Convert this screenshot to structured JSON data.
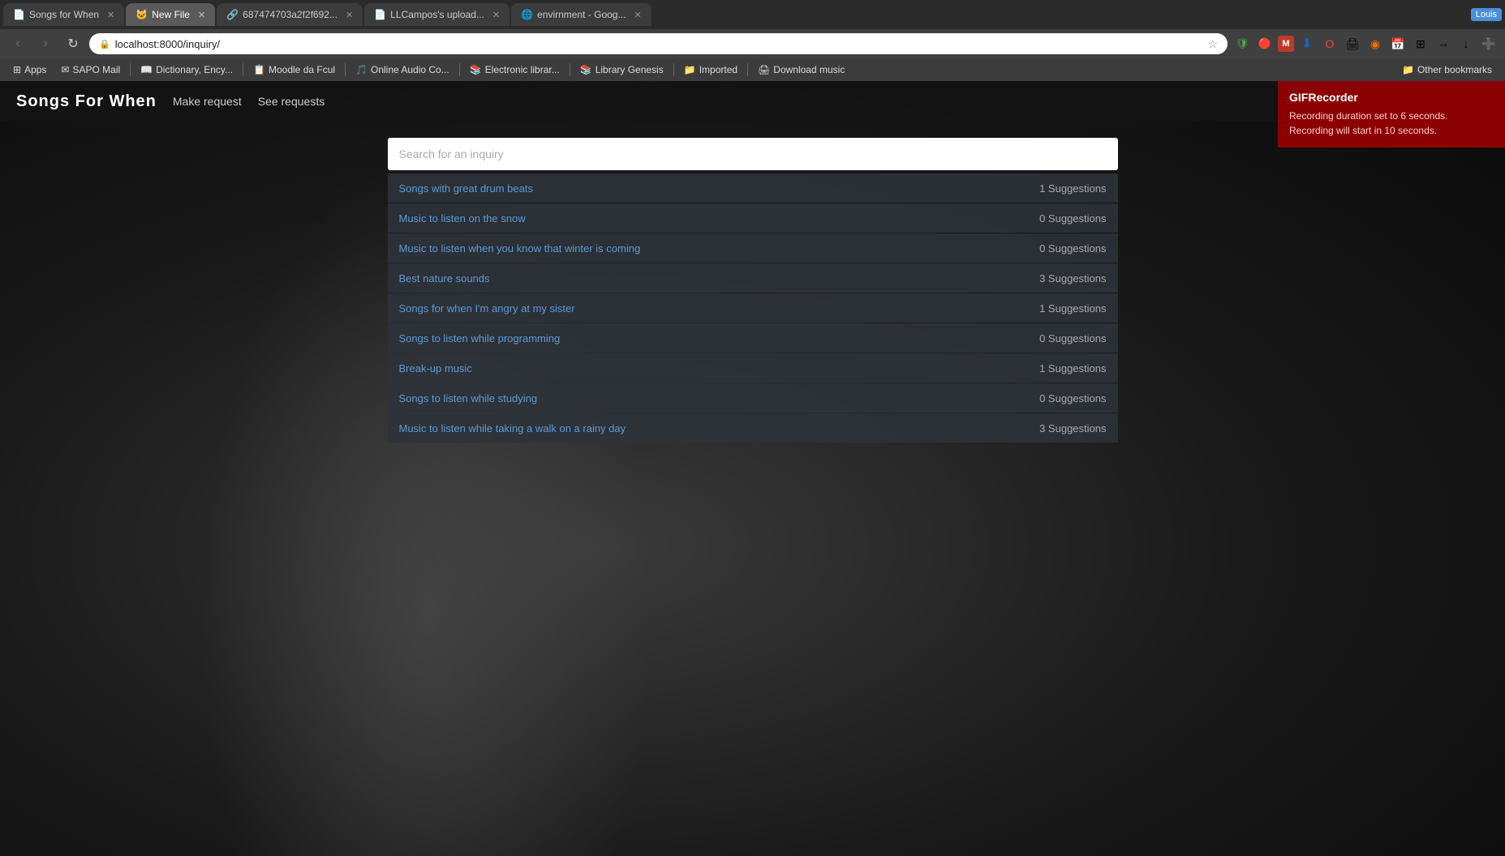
{
  "browser": {
    "tabs": [
      {
        "id": "tab1",
        "label": "Songs for When",
        "icon": "📄",
        "active": false,
        "favicon": "page"
      },
      {
        "id": "tab2",
        "label": "New File",
        "icon": "📄",
        "active": true,
        "favicon": "github"
      },
      {
        "id": "tab3",
        "label": "687474703a2f2f692...",
        "icon": "🔗",
        "active": false,
        "favicon": "link"
      },
      {
        "id": "tab4",
        "label": "LLCampos's upload...",
        "icon": "📄",
        "active": false,
        "favicon": "page"
      },
      {
        "id": "tab5",
        "label": "envirnment - Goog...",
        "icon": "🌐",
        "active": false,
        "favicon": "google"
      }
    ],
    "address": "localhost:8000/inquiry/",
    "address_display": "localhost:8000/inquiry/"
  },
  "bookmarks": [
    {
      "label": "Apps",
      "icon": "⊞"
    },
    {
      "label": "SAPO Mail",
      "icon": "✉"
    },
    {
      "label": "Dictionary, Ency...",
      "icon": "📖"
    },
    {
      "label": "Moodle da Fcul",
      "icon": "🎓"
    },
    {
      "label": "Online Audio Co...",
      "icon": "🎵"
    },
    {
      "label": "Electronic librar...",
      "icon": "📚"
    },
    {
      "label": "Library Genesis",
      "icon": "📚"
    },
    {
      "label": "Imported",
      "icon": "📁"
    },
    {
      "label": "Download music",
      "icon": "🖨"
    },
    {
      "label": "Other bookmarks",
      "icon": "📁"
    }
  ],
  "app": {
    "brand": "Songs For When",
    "nav_links": [
      {
        "label": "Make request",
        "href": "#"
      },
      {
        "label": "See requests",
        "href": "#"
      }
    ]
  },
  "search": {
    "placeholder": "Search for an inquiry"
  },
  "inquiries": [
    {
      "title": "Songs with great drum beats",
      "suggestions": 1,
      "suggestions_label": "1 Suggestions"
    },
    {
      "title": "Music to listen on the snow",
      "suggestions": 0,
      "suggestions_label": "0 Suggestions"
    },
    {
      "title": "Music to listen when you know that winter is coming",
      "suggestions": 0,
      "suggestions_label": "0 Suggestions"
    },
    {
      "title": "Best nature sounds",
      "suggestions": 3,
      "suggestions_label": "3 Suggestions"
    },
    {
      "title": "Songs for when I'm angry at my sister",
      "suggestions": 1,
      "suggestions_label": "1 Suggestions"
    },
    {
      "title": "Songs to listen while programming",
      "suggestions": 0,
      "suggestions_label": "0 Suggestions"
    },
    {
      "title": "Break-up music",
      "suggestions": 1,
      "suggestions_label": "1 Suggestions"
    },
    {
      "title": "Songs to listen while studying",
      "suggestions": 0,
      "suggestions_label": "0 Suggestions"
    },
    {
      "title": "Music to listen while taking a walk on a rainy day",
      "suggestions": 3,
      "suggestions_label": "3 Suggestions"
    }
  ],
  "gif_recorder": {
    "title": "GIFRecorder",
    "text": "Recording duration set to 6 seconds. Recording will start in 10 seconds."
  },
  "louds_badge": "Louis"
}
